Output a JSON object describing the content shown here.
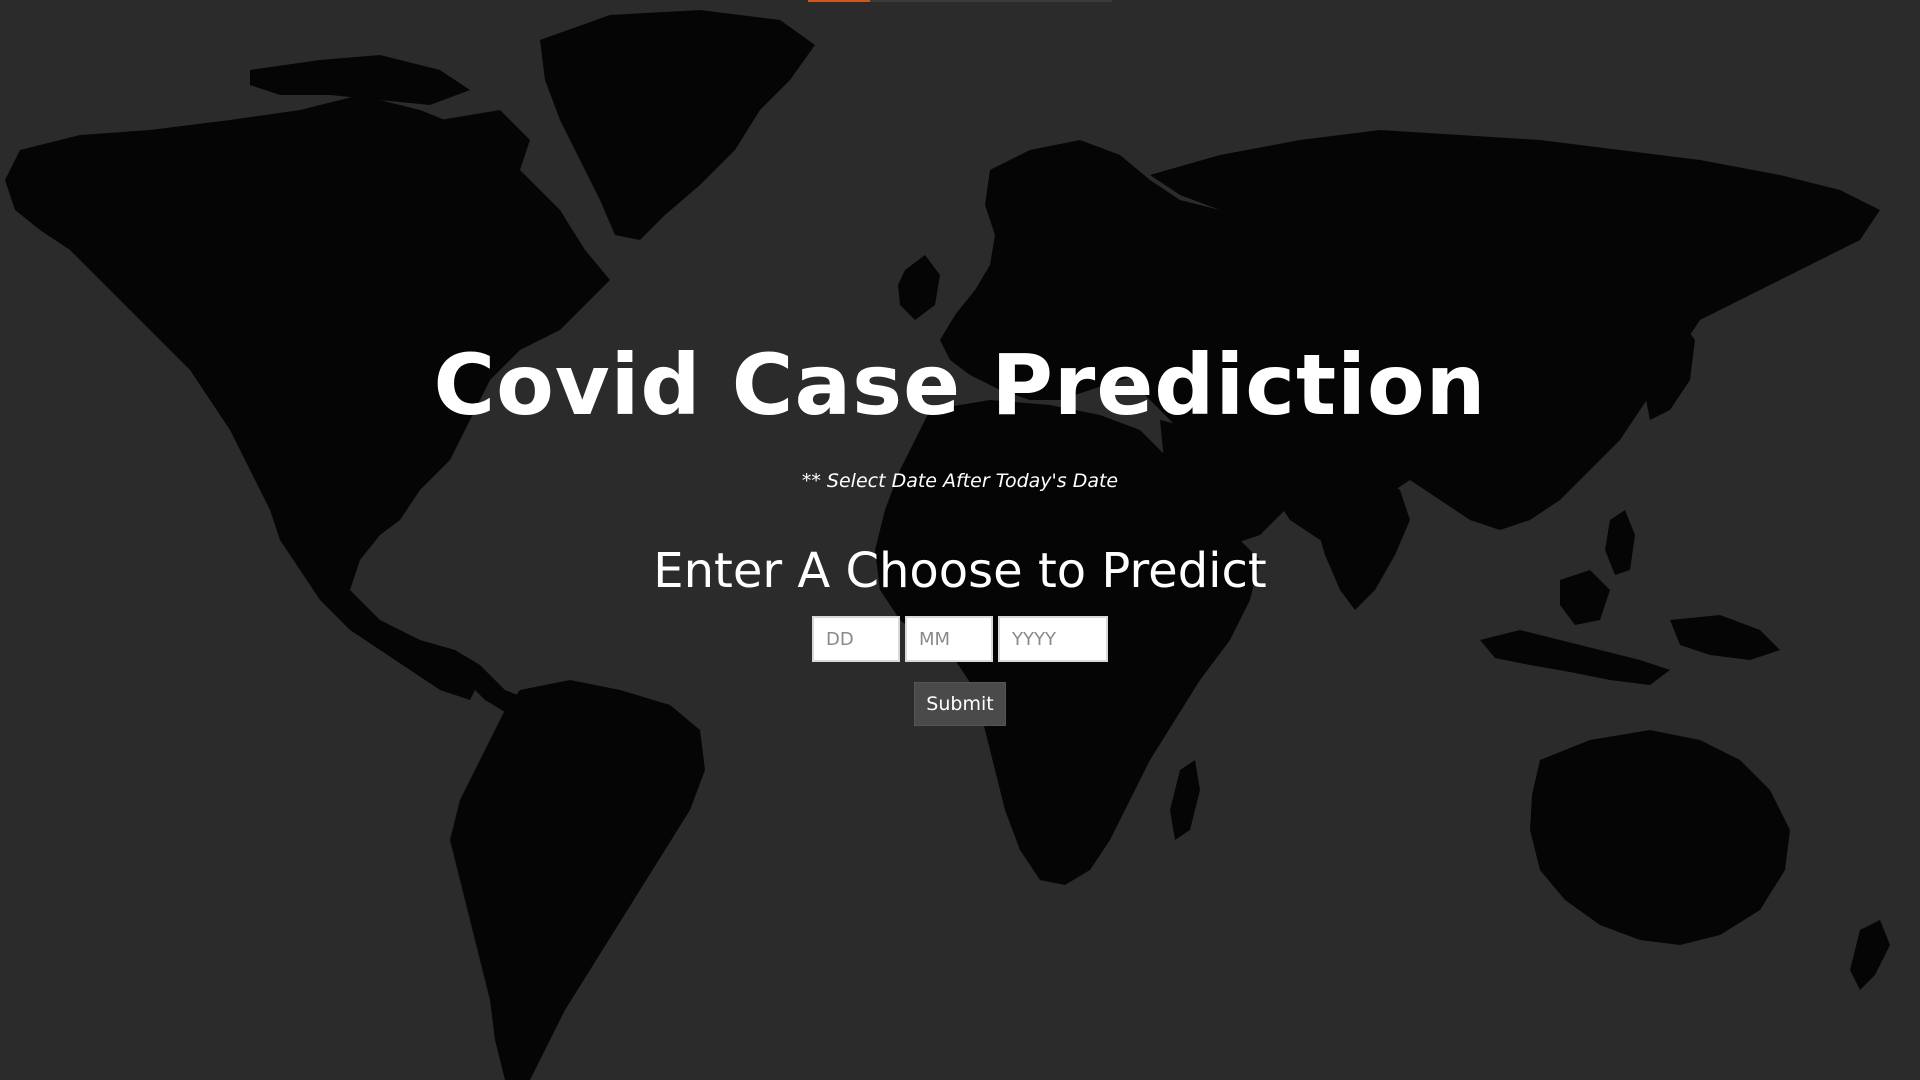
{
  "theme": {
    "background": "#2b2b2b",
    "map_land": "#050505",
    "accent": "#d2561a",
    "text": "#ffffff"
  },
  "header": {
    "title": "Covid Case Prediction",
    "note": "** Select Date After Today's Date"
  },
  "form": {
    "heading": "Enter A Choose to Predict",
    "day_placeholder": "DD",
    "month_placeholder": "MM",
    "year_placeholder": "YYYY",
    "submit_label": "Submit"
  }
}
